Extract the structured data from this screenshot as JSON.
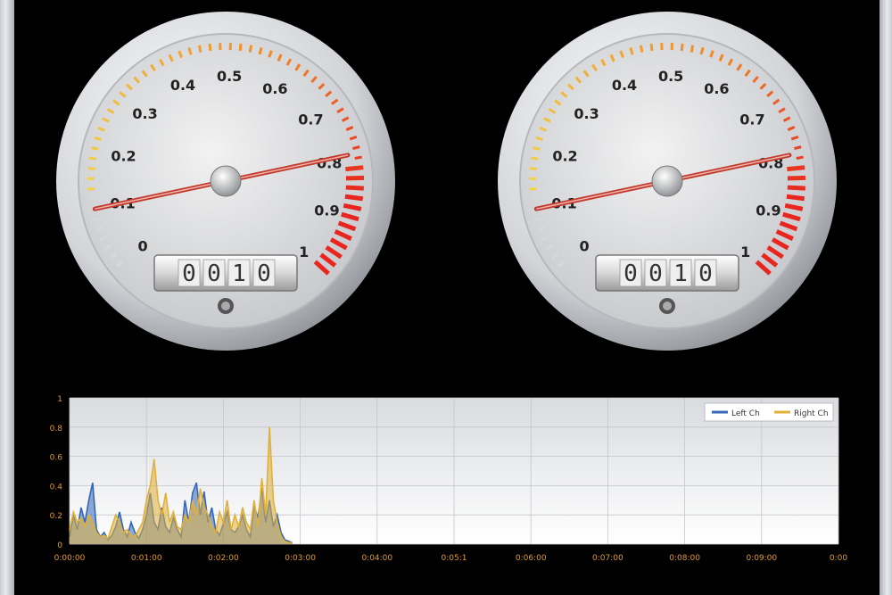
{
  "gauges": [
    {
      "id": "left",
      "value": 0.1,
      "counter": [
        "0",
        "0",
        "1",
        "0"
      ],
      "dial_labels": [
        "0",
        "0.1",
        "0.2",
        "0.3",
        "0.4",
        "0.5",
        "0.6",
        "0.7",
        "0.8",
        "0.9",
        "1"
      ]
    },
    {
      "id": "right",
      "value": 0.1,
      "counter": [
        "0",
        "0",
        "1",
        "0"
      ],
      "dial_labels": [
        "0",
        "0.1",
        "0.2",
        "0.3",
        "0.4",
        "0.5",
        "0.6",
        "0.7",
        "0.8",
        "0.9",
        "1"
      ]
    }
  ],
  "colors": {
    "background": "#000000",
    "needle": "#c0392b",
    "scale_low": "#f2d64b",
    "scale_mid": "#f08c2a",
    "scale_high": "#e8261f",
    "series_left": "#3566b8",
    "series_right": "#e0b03a",
    "axis_tick_text": "#e39b2c"
  },
  "chart_data": {
    "type": "area",
    "ylim": [
      0,
      1
    ],
    "yticks": [
      "0",
      "0.2",
      "0.4",
      "0.6",
      "0.8",
      "1"
    ],
    "xticks": [
      "0:00:00",
      "0:01:00",
      "0:02:00",
      "0:03:00",
      "0:04:00",
      "0:05:1",
      "0:06:00",
      "0:07:00",
      "0:08:00",
      "0:09:00",
      "0:00"
    ],
    "legend_position": "top-right",
    "grid": true,
    "x_range_min": [
      0,
      10
    ],
    "series": [
      {
        "name": "Left Ch",
        "color": "#3566b8",
        "x_min": [
          0,
          0.05,
          0.1,
          0.15,
          0.2,
          0.25,
          0.3,
          0.35,
          0.4,
          0.45,
          0.5,
          0.55,
          0.6,
          0.65,
          0.7,
          0.75,
          0.8,
          0.85,
          0.9,
          0.95,
          1.0,
          1.05,
          1.1,
          1.15,
          1.2,
          1.25,
          1.3,
          1.35,
          1.4,
          1.45,
          1.5,
          1.55,
          1.6,
          1.65,
          1.7,
          1.75,
          1.8,
          1.85,
          1.9,
          1.95,
          2.0,
          2.05,
          2.1,
          2.15,
          2.2,
          2.25,
          2.3,
          2.35,
          2.4,
          2.45,
          2.5,
          2.55,
          2.6,
          2.65,
          2.7,
          2.75,
          2.8,
          2.85,
          2.9
        ],
        "values": [
          0.05,
          0.2,
          0.1,
          0.25,
          0.15,
          0.3,
          0.42,
          0.1,
          0.05,
          0.08,
          0.03,
          0.06,
          0.12,
          0.22,
          0.1,
          0.05,
          0.15,
          0.08,
          0.04,
          0.1,
          0.2,
          0.35,
          0.15,
          0.1,
          0.25,
          0.12,
          0.08,
          0.18,
          0.1,
          0.05,
          0.3,
          0.15,
          0.35,
          0.42,
          0.2,
          0.36,
          0.15,
          0.25,
          0.1,
          0.06,
          0.14,
          0.22,
          0.1,
          0.08,
          0.12,
          0.2,
          0.1,
          0.05,
          0.26,
          0.18,
          0.38,
          0.15,
          0.3,
          0.12,
          0.2,
          0.08,
          0.03,
          0.02,
          0.01
        ]
      },
      {
        "name": "Right Ch",
        "color": "#e0b03a",
        "x_min": [
          0,
          0.05,
          0.1,
          0.15,
          0.2,
          0.25,
          0.3,
          0.35,
          0.4,
          0.45,
          0.5,
          0.55,
          0.6,
          0.65,
          0.7,
          0.75,
          0.8,
          0.85,
          0.9,
          0.95,
          1.0,
          1.05,
          1.1,
          1.15,
          1.2,
          1.25,
          1.3,
          1.35,
          1.4,
          1.45,
          1.5,
          1.55,
          1.6,
          1.65,
          1.7,
          1.75,
          1.8,
          1.85,
          1.9,
          1.95,
          2.0,
          2.05,
          2.1,
          2.15,
          2.2,
          2.25,
          2.3,
          2.35,
          2.4,
          2.45,
          2.5,
          2.55,
          2.6,
          2.65,
          2.7,
          2.75,
          2.8,
          2.85,
          2.9
        ],
        "values": [
          0.1,
          0.22,
          0.15,
          0.18,
          0.12,
          0.2,
          0.15,
          0.08,
          0.05,
          0.06,
          0.04,
          0.12,
          0.2,
          0.15,
          0.08,
          0.1,
          0.06,
          0.05,
          0.1,
          0.15,
          0.3,
          0.4,
          0.58,
          0.3,
          0.2,
          0.35,
          0.15,
          0.22,
          0.12,
          0.1,
          0.2,
          0.15,
          0.3,
          0.2,
          0.38,
          0.26,
          0.2,
          0.12,
          0.08,
          0.22,
          0.15,
          0.3,
          0.1,
          0.2,
          0.12,
          0.25,
          0.15,
          0.1,
          0.3,
          0.12,
          0.45,
          0.2,
          0.8,
          0.3,
          0.15,
          0.05,
          0.02,
          0.01,
          0.01
        ]
      }
    ]
  }
}
